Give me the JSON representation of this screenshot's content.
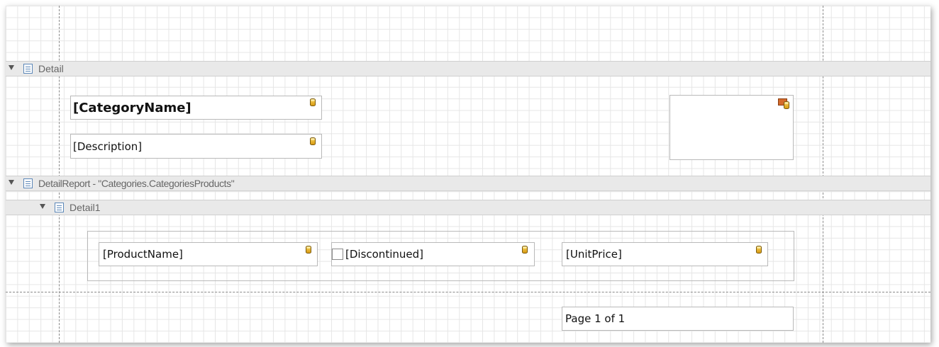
{
  "bands": {
    "detail": {
      "label": "Detail"
    },
    "detail_report": {
      "label": "DetailReport - \"Categories.CategoriesProducts\""
    },
    "detail1": {
      "label": "Detail1"
    }
  },
  "fields": {
    "category_name": "[CategoryName]",
    "description": "[Description]",
    "product_name": "[ProductName]",
    "discontinued": "[Discontinued]",
    "unit_price": "[UnitPrice]",
    "page_info": "Page 1 of 1"
  },
  "icons": {
    "band_toggle": "triangle-down-icon",
    "band_icon": "band-icon",
    "field_binding": "database-icon",
    "picture_box": "picture-box-icon"
  },
  "colors": {
    "band_background": "#e9e9e9",
    "grid_line": "#e6e6e6",
    "guide_line": "#8a8a8a",
    "band_icon_blue": "#5b87b8",
    "db_gold": "#e8b52a"
  }
}
